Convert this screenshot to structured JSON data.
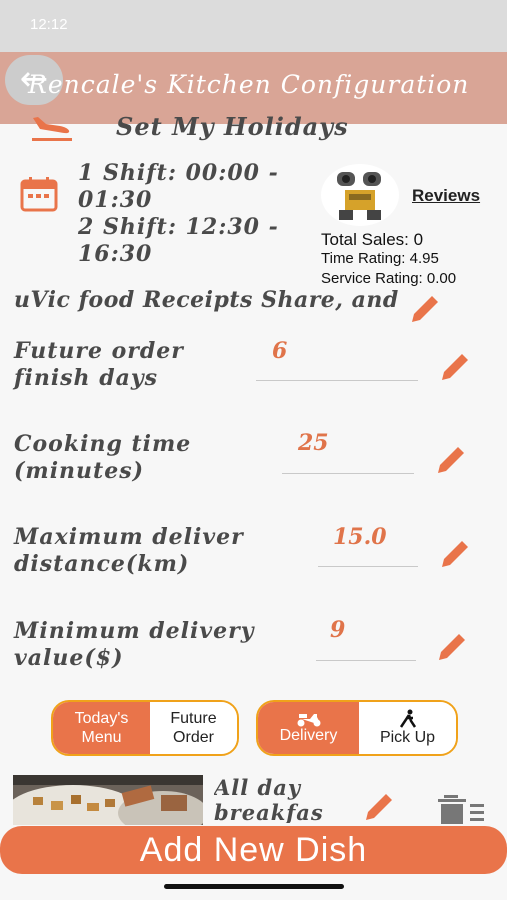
{
  "colors": {
    "accent": "#e9744a",
    "header": "#d9a596",
    "segment_border": "#f0a21a",
    "background": "#f7f7f7"
  },
  "status_bar": {
    "time": "12:12",
    "right": ""
  },
  "header": {
    "back_icon": "back-arrow-icon",
    "title": "Rencale's Kitchen Configuration"
  },
  "holidays": {
    "icon": "airplane-landing-icon",
    "label": "Set My Holidays"
  },
  "shifts": {
    "icon": "calendar-icon",
    "shift1": "1 Shift: 00:00 - 01:30",
    "shift2": "2 Shift: 12:30 - 16:30"
  },
  "stats": {
    "avatar_icon": "robot-avatar",
    "reviews_label": "Reviews",
    "total_sales": "Total Sales: 0",
    "time_rating": "Time Rating: 4.95",
    "service_rating": "Service Rating: 0.00"
  },
  "receipts": {
    "label": "uVic food Receipts Share, and"
  },
  "fields": [
    {
      "label": "Future order finish days",
      "value": "6"
    },
    {
      "label": "Cooking time (minutes)",
      "value": "25"
    },
    {
      "label": "Maximum deliver distance(km)",
      "value": "15.0"
    },
    {
      "label": "Minimum delivery value($)",
      "value": "9"
    }
  ],
  "menu_toggle": {
    "options": [
      "Today's Menu",
      "Future Order"
    ],
    "selected": "Today's Menu"
  },
  "service_toggle": {
    "options": [
      {
        "label": "Delivery",
        "icon": "scooter-icon"
      },
      {
        "label": "Pick Up",
        "icon": "walking-person-icon"
      }
    ],
    "selected": "Delivery"
  },
  "dish": {
    "name": "All day breakfast"
  },
  "add_button": {
    "label": "Add New Dish"
  }
}
